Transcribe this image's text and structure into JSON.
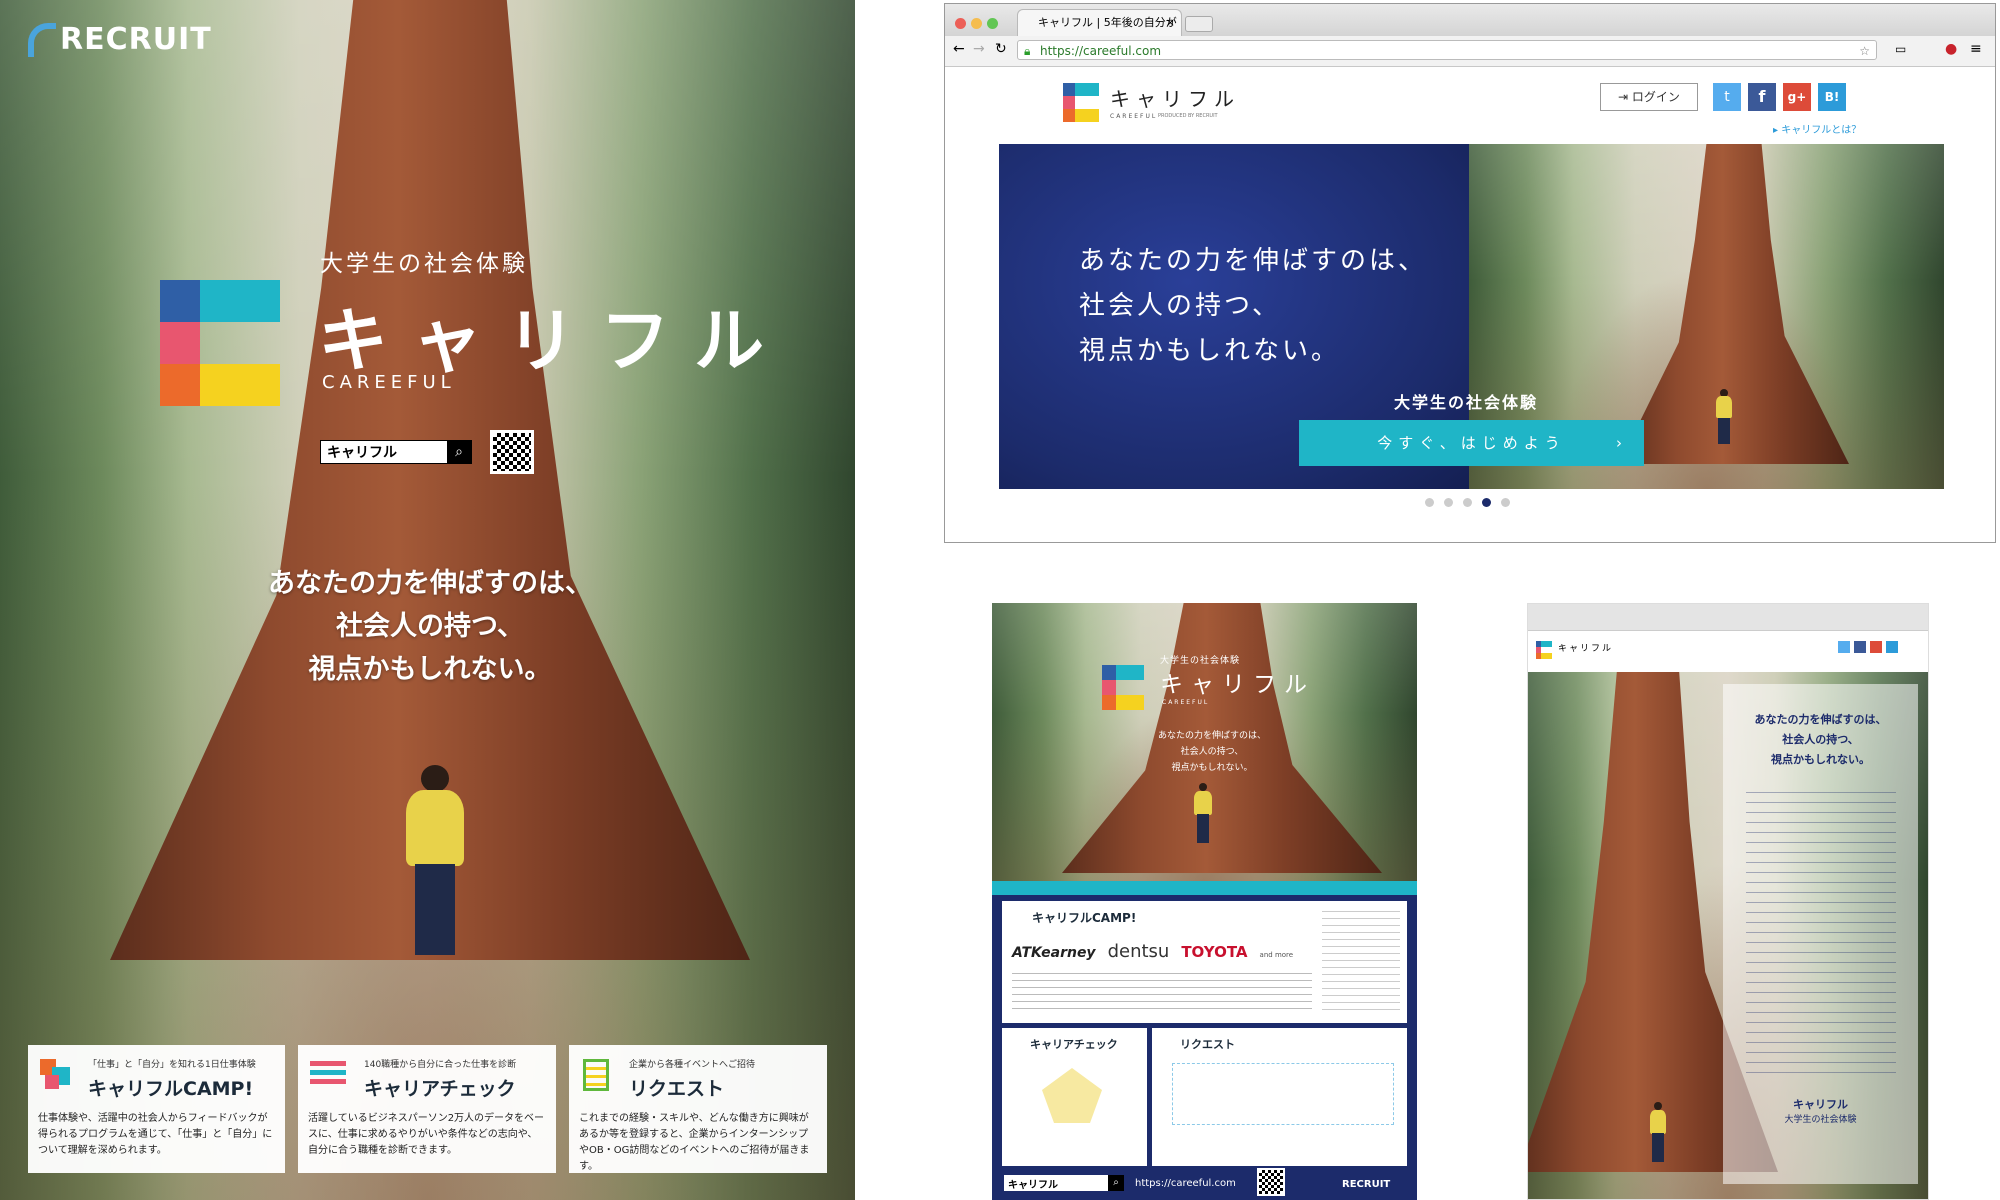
{
  "poster": {
    "brand": "RECRUIT",
    "tagline": "大学生の社会体験",
    "logo_text": "キャリフル",
    "logo_sub": "CAREEFUL",
    "search_text": "キャリフル",
    "headline": [
      "あなたの力を伸ばすのは、",
      "社会人の持つ、",
      "視点かもしれない。"
    ],
    "cards": [
      {
        "kicker": "「仕事」と「自分」を知れる1日仕事体験",
        "title": "キャリフルCAMP!",
        "body": "仕事体験や、活躍中の社会人からフィードバックが得られるプログラムを通じて、「仕事」と「自分」について理解を深められます。"
      },
      {
        "kicker": "140職種から自分に合った仕事を診断",
        "title": "キャリアチェック",
        "body": "活躍しているビジネスパーソン2万人のデータをベースに、仕事に求めるやりがいや条件などの志向や、自分に合う職種を診断できます。"
      },
      {
        "kicker": "企業から各種イベントへご招待",
        "title": "リクエスト",
        "body": "これまでの経験・スキルや、どんな働き方に興味があるか等を登録すると、企業からインターンシップやOB・OG訪問などのイベントへのご招待が届きます。"
      }
    ]
  },
  "browser": {
    "tab_title": "キャリフル | 5年後の自分が",
    "url": "https://careeful.com",
    "logo_text": "キャリフル",
    "logo_sub": "CAREEFUL",
    "logo_credit": "PRODUCED BY RECRUIT",
    "login_label": "ログイン",
    "about_link": "キャリフルとは？",
    "hero_headline": [
      "あなたの力を伸ばすのは、",
      "社会人の持つ、",
      "視点かもしれない。"
    ],
    "hero_tagline": "大学生の社会体験",
    "cta_label": "今すぐ、はじめよう",
    "active_dot": 4,
    "dots": 5
  },
  "flyer": {
    "tagline": "大学生の社会体験",
    "logo_text": "キャリフル",
    "logo_sub": "CAREEFUL",
    "headline": [
      "あなたの力を伸ばすのは、",
      "社会人の持つ、",
      "視点かもしれない。"
    ],
    "camp_title": "キャリフルCAMP!",
    "partners": [
      "ATKearney",
      "dentsu",
      "TOYOTA",
      "and more"
    ],
    "check_title": "キャリアチェック",
    "request_title": "リクエスト",
    "search_text": "キャリフル",
    "url": "https://careeful.com",
    "brand": "RECRUIT"
  },
  "landing": {
    "logo_text": "キャリフル",
    "headline": [
      "あなたの力を伸ばすのは、",
      "社会人の持つ、",
      "視点かもしれない。"
    ],
    "signature": "キャリフル",
    "signature_sub": "大学生の社会体験"
  },
  "colors": {
    "teal": "#1fb5c7",
    "navy": "#1c2b6b",
    "yellow": "#f5d21f",
    "pink": "#e8566f",
    "orange": "#ec6a2b",
    "blue": "#2f5fa6"
  }
}
